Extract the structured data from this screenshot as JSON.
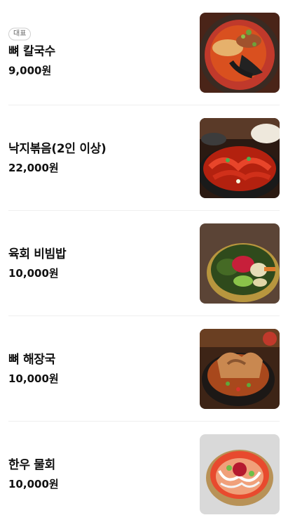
{
  "menu": {
    "items": [
      {
        "badge": "대표",
        "name": "뼈 칼국수",
        "price": "9,000원",
        "image": "bone-kalguksu-photo"
      },
      {
        "name": "낙지볶음(2인 이상)",
        "price": "22,000원",
        "image": "stir-fried-octopus-photo"
      },
      {
        "name": "육회 비빔밥",
        "price": "10,000원",
        "image": "yukhoe-bibimbap-photo"
      },
      {
        "name": "뼈 해장국",
        "price": "10,000원",
        "image": "bone-haejangguk-photo"
      },
      {
        "name": "한우 물회",
        "price": "10,000원",
        "image": "hanwoo-mulhoe-photo"
      }
    ]
  }
}
